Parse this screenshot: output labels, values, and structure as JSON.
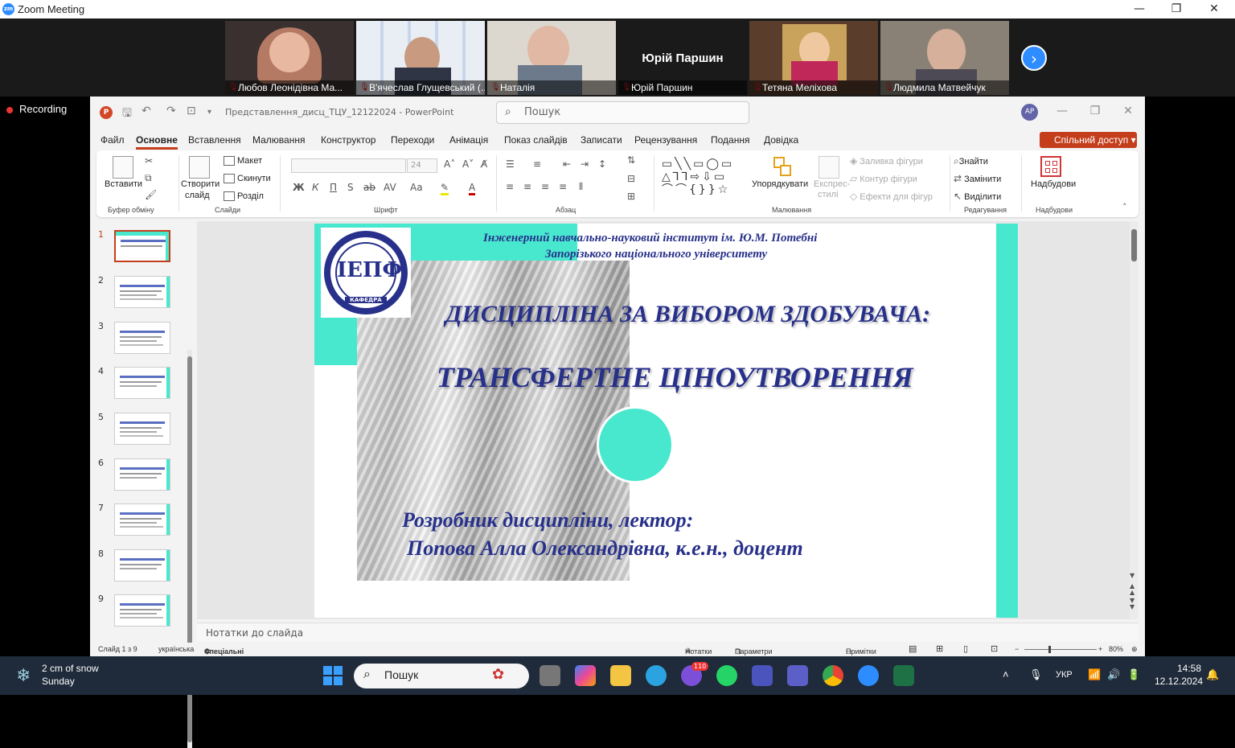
{
  "zoom": {
    "window_title": "Zoom Meeting",
    "recording_label": "Recording",
    "participants": [
      {
        "name": "Любов Леонідівна Ма..."
      },
      {
        "name": "В'ячеслав Глущевський (..."
      },
      {
        "name": "Наталія"
      },
      {
        "name": "Юрій Паршин",
        "display_text": "Юрій Паршин"
      },
      {
        "name": "Тетяна Меліхова"
      },
      {
        "name": "Людмила Матвейчук"
      }
    ]
  },
  "ppt": {
    "title": "Представлення_дисц_ТЦУ_12122024  -  PowerPoint",
    "search_placeholder": "Пошук",
    "avatar": "АР",
    "menu": [
      "Файл",
      "Основне",
      "Вставлення",
      "Малювання",
      "Конструктор",
      "Переходи",
      "Анімація",
      "Показ слайдів",
      "Записати",
      "Рецензування",
      "Подання",
      "Довідка"
    ],
    "share_label": "Спільний доступ",
    "ribbon": {
      "paste": "Вставити",
      "new_slide_1": "Створити",
      "new_slide_2": "слайд",
      "layout": "Макет",
      "reset": "Скинути",
      "section": "Розділ",
      "font_size": "24",
      "arrange": "Упорядкувати",
      "express_1": "Експрес-",
      "express_2": "стилі",
      "fill": "Заливка фігури",
      "outline": "Контур фігури",
      "effects": "Ефекти для фігур",
      "find": "Знайти",
      "replace": "Замінити",
      "select": "Виділити",
      "addins": "Надбудови",
      "groups": [
        "Буфер обміну",
        "Слайди",
        "Шрифт",
        "Абзац",
        "Малювання",
        "Редагування",
        "Надбудови"
      ]
    },
    "thumbnails": [
      "1",
      "2",
      "3",
      "4",
      "5",
      "6",
      "7",
      "8",
      "9"
    ],
    "slide": {
      "institute_line1": "Інженерний навчально-науковий інститут ім. Ю.М. Потебні",
      "institute_line2": "Запорізького національного університету",
      "heading1": "ДИСЦИПЛІНА ЗА ВИБОРОМ ЗДОБУВАЧА:",
      "heading2": "ТРАНСФЕРТНЕ ЦІНОУТВОРЕННЯ",
      "author_label": "Розробник дисципліни, лектор:",
      "author_name": "Попова Алла Олександрівна, к.е.н., доцент",
      "logo_text": "ІЕПФ",
      "logo_sub": "КАФЕДРА"
    },
    "notes_placeholder": "Нотатки до слайда",
    "status": {
      "slide_of": "Слайд 1 з 9",
      "language": "українська",
      "accessibility": "Спеціальні можливості: щось не так",
      "notes": "Нотатки",
      "display": "Параметри відображення",
      "comments": "Примітки",
      "zoom": "80%"
    }
  },
  "taskbar": {
    "weather_line1": "2 cm of snow",
    "weather_line2": "Sunday",
    "search_placeholder": "Пошук",
    "viber_badge": "110",
    "lang": "УКР",
    "time": "14:58",
    "date": "12.12.2024"
  },
  "colors": {
    "accent_teal": "#48e8cf",
    "slide_text": "#27308a",
    "ppt_accent": "#c43e1c",
    "zoom_blue": "#2d8cff"
  }
}
